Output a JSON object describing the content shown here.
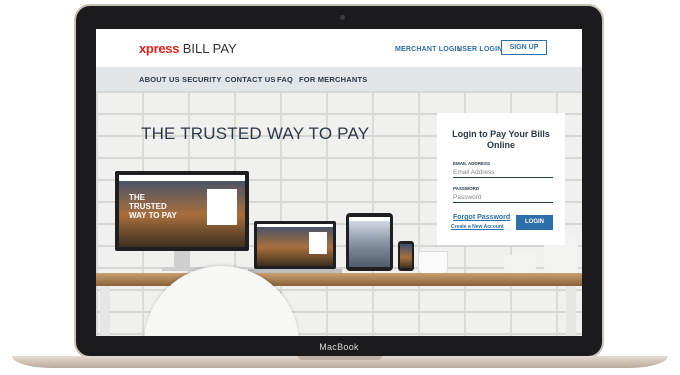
{
  "device": {
    "brand_label": "MacBook"
  },
  "header": {
    "logo_primary": "xpress",
    "logo_secondary": "BILL PAY",
    "merchant_login": "MERCHANT LOGIN",
    "user_login": "USER LOGIN",
    "sign_up": "SIGN UP"
  },
  "nav": {
    "items": [
      {
        "label": "ABOUT US"
      },
      {
        "label": "SECURITY"
      },
      {
        "label": "CONTACT US"
      },
      {
        "label": "FAQ"
      },
      {
        "label": "FOR MERCHANTS"
      }
    ]
  },
  "hero": {
    "title": "THE TRUSTED WAY TO PAY",
    "device_screen_title": "THE TRUSTED WAY TO PAY"
  },
  "login": {
    "title": "Login to Pay Your Bills Online",
    "email_label": "EMAIL ADDRESS",
    "email_placeholder": "Email Address",
    "password_label": "PASSWORD",
    "password_placeholder": "Password",
    "forgot_password": "Forgot Password",
    "create_account": "Create a New Account",
    "login_button": "LOGIN"
  },
  "colors": {
    "brand_red": "#e2231a",
    "link_blue": "#2d6fa8",
    "navy_text": "#2a3846"
  }
}
